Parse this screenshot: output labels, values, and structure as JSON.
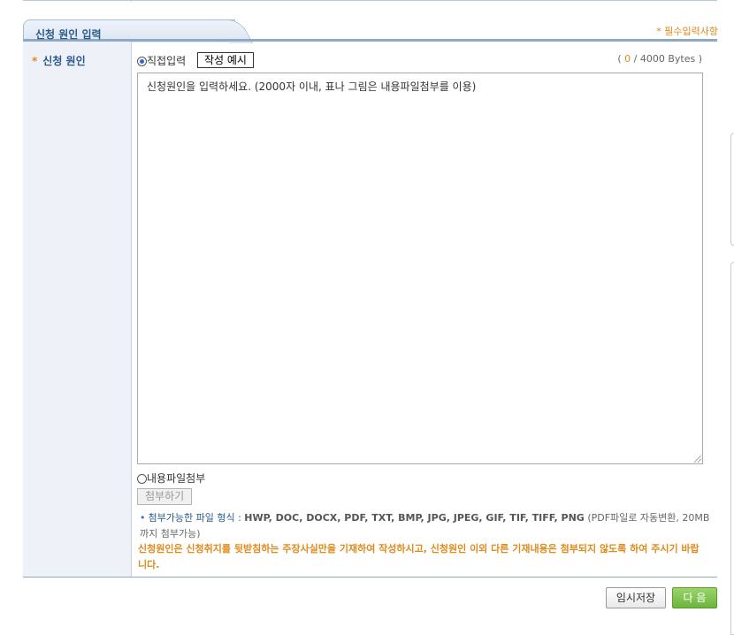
{
  "section": {
    "title": "신청 원인 입력",
    "required_note": "* 필수입력사항"
  },
  "field": {
    "label": "신청 원인",
    "star": "*"
  },
  "input": {
    "direct_option": "직접입력",
    "example_button": "작성 예시",
    "bytes_open": "( ",
    "bytes_count": "0",
    "bytes_rest": " / 4000 Bytes )",
    "placeholder": "신청원인을 입력하세요. (2000자 이내, 표나 그림은 내용파일첨부를 이용)"
  },
  "file": {
    "option": "내용파일첨부",
    "attach_button": "첨부하기",
    "formats_label": "첨부가능한 파일 형식 : ",
    "formats_types": "HWP, DOC, DOCX, PDF, TXT, BMP, JPG, JPEG, GIF, TIF, TIFF, PNG",
    "formats_note": " (PDF파일로 자동변환, 20MB까지 첨부가능)"
  },
  "warning": "신청원인은 신청취지를 뒷받침하는 주장사실만을 기재하여 작성하시고, 신청원인 이외 다른 기재내용은 첨부되지 않도록 하여 주시기 바랍니다.",
  "actions": {
    "save": "임시저장",
    "next": "다 음"
  },
  "colors": {
    "accent_orange": "#e08a1a",
    "header_blue": "#2a5a8a",
    "next_green": "#6db43c"
  }
}
